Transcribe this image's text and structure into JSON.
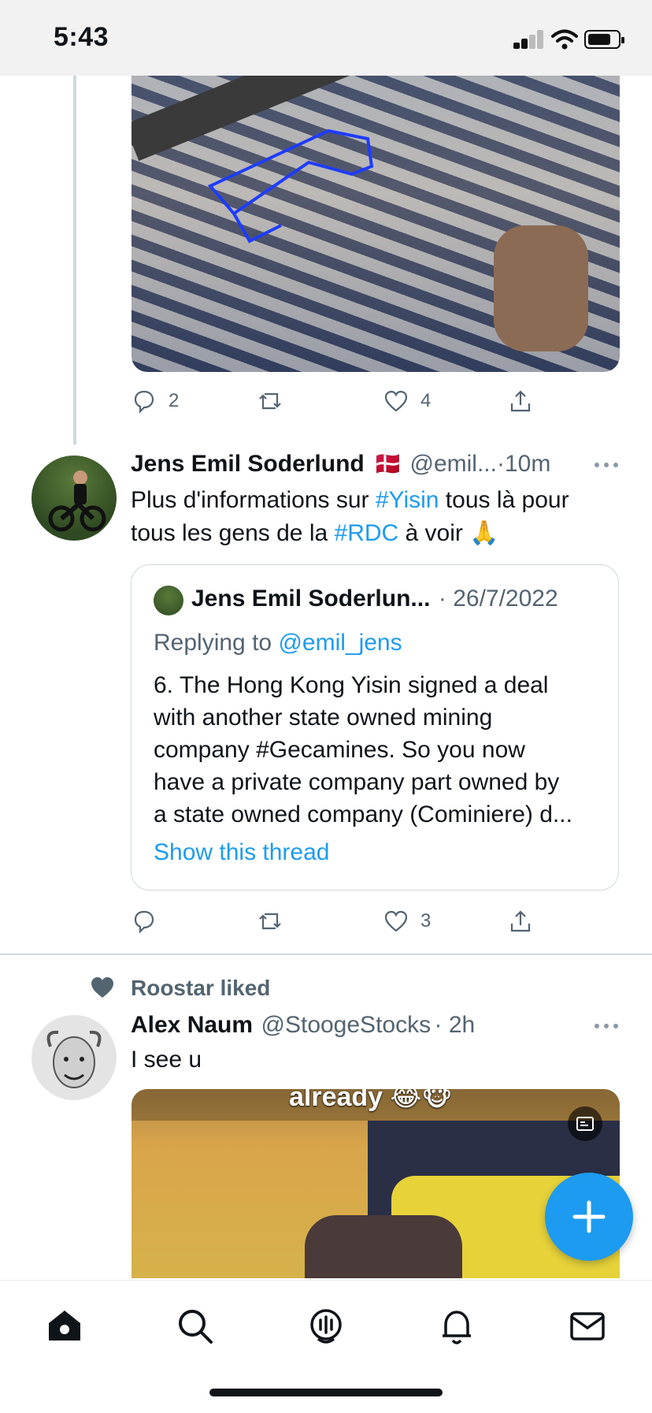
{
  "status": {
    "time": "5:43"
  },
  "tweet1": {
    "reply_count": "2",
    "like_count": "4"
  },
  "tweet2": {
    "author": "Jens Emil Soderlund",
    "flag": "🇩🇰",
    "handle": "@emil...",
    "sep": "·",
    "time": "10m",
    "text_a": "Plus d'informations sur ",
    "hashtag1": "#Yisin",
    "text_b": " tous là pour",
    "text_c": "tous les gens de la ",
    "hashtag2": "#RDC",
    "text_d": " à voir 🙏",
    "like_count": "3",
    "quote": {
      "author": "Jens Emil Soderlun...",
      "date": "· 26/7/2022",
      "replying_to": "Replying to ",
      "replying_handle": "@emil_jens",
      "lines": [
        "6. The Hong Kong Yisin signed a deal",
        "with another state owned mining",
        "company #Gecamines. So you now",
        "have a private company part owned by",
        "a state owned company (Cominiere) d..."
      ],
      "show_thread": "Show this thread"
    }
  },
  "tweet3": {
    "social_context": "Roostar liked",
    "author": "Alex Naum",
    "handle": "@StoogeStocks",
    "time": "· 2h",
    "text": "I see u",
    "image_caption": "already 😂🐵"
  },
  "colors": {
    "accent": "#1d9bf0",
    "muted": "#536471",
    "border": "#cfd9de"
  },
  "icons": [
    "reply-icon",
    "retweet-icon",
    "like-icon",
    "share-icon",
    "more-icon",
    "home-icon",
    "search-icon",
    "spaces-icon",
    "notifications-icon",
    "messages-icon",
    "compose-icon"
  ]
}
